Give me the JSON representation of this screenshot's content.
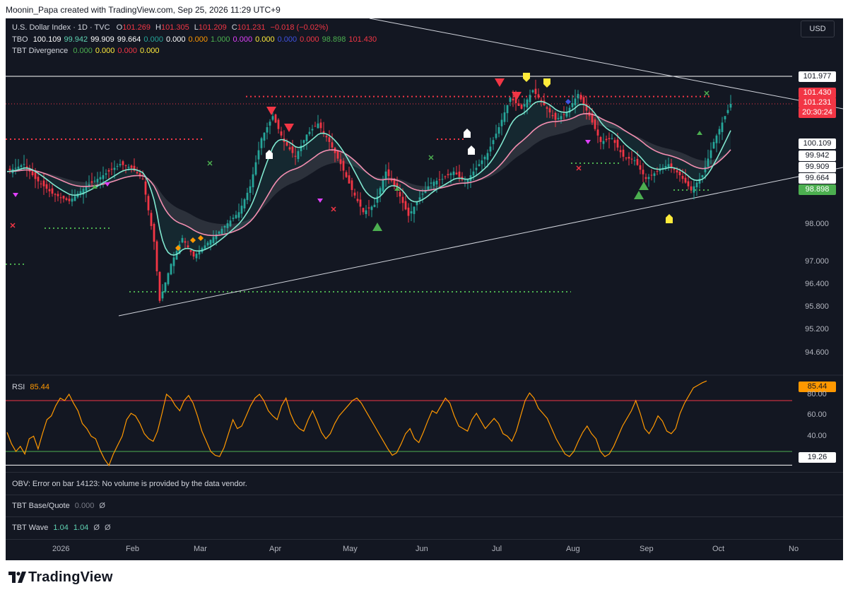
{
  "header": {
    "credit": "Moonin_Papa created with TradingView.com, Sep 25, 2026 11:29 UTC+9"
  },
  "legend": {
    "symbol": "U.S. Dollar Index · 1D · TVC",
    "o_label": "O",
    "o_value": "101.269",
    "h_label": "H",
    "h_value": "101.305",
    "l_label": "L",
    "l_value": "101.209",
    "c_label": "C",
    "c_value": "101.231",
    "change": "−0.018 (−0.02%)",
    "tbo_label": "TBO",
    "tbo_values": [
      {
        "text": "100.109",
        "color": "#ffffff"
      },
      {
        "text": "99.942",
        "color": "#5fd3b3"
      },
      {
        "text": "99.909",
        "color": "#ffffff"
      },
      {
        "text": "99.664",
        "color": "#ffffff"
      },
      {
        "text": "0.000",
        "color": "#26a69a"
      },
      {
        "text": "0.000",
        "color": "#ffffff"
      },
      {
        "text": "0.000",
        "color": "#ff9800"
      },
      {
        "text": "1.000",
        "color": "#4caf50"
      },
      {
        "text": "0.000",
        "color": "#e040fb"
      },
      {
        "text": "0.000",
        "color": "#ffeb3b"
      },
      {
        "text": "0.000",
        "color": "#3f51e0"
      },
      {
        "text": "0.000",
        "color": "#f23645"
      },
      {
        "text": "98.898",
        "color": "#4caf50"
      },
      {
        "text": "101.430",
        "color": "#f23645"
      }
    ],
    "div_label": "TBT Divergence",
    "div_values": [
      {
        "text": "0.000",
        "color": "#4caf50"
      },
      {
        "text": "0.000",
        "color": "#ffeb3b"
      },
      {
        "text": "0.000",
        "color": "#f23645"
      },
      {
        "text": "0.000",
        "color": "#ffeb3b"
      }
    ]
  },
  "currency_button": "USD",
  "price_axis": {
    "ticks": [
      "98.000",
      "97.000",
      "96.400",
      "95.800",
      "95.200",
      "94.600"
    ],
    "tags": [
      {
        "text": "101.977",
        "bg": "#ffffff",
        "fg": "#131722"
      },
      {
        "text": "101.430",
        "bg": "#f23645",
        "fg": "#ffffff"
      },
      {
        "text": "101.231",
        "bg": "#f23645",
        "fg": "#ffffff"
      },
      {
        "text": "20:30:24",
        "bg": "#f23645",
        "fg": "#ffffff"
      },
      {
        "text": "100.109",
        "bg": "#ffffff",
        "fg": "#131722"
      },
      {
        "text": "99.942",
        "bg": "#ffffff",
        "fg": "#131722"
      },
      {
        "text": "99.909",
        "bg": "#ffffff",
        "fg": "#131722"
      },
      {
        "text": "99.664",
        "bg": "#ffffff",
        "fg": "#131722"
      },
      {
        "text": "98.898",
        "bg": "#4caf50",
        "fg": "#ffffff"
      }
    ]
  },
  "rsi": {
    "label": "RSI",
    "value": "85.44",
    "ticks": [
      "80.00",
      "60.00",
      "40.00"
    ],
    "tag_value": "85.44",
    "low_tag": "19.26"
  },
  "obv": {
    "label": "OBV: Error on bar 14123: No volume is provided by the data vendor."
  },
  "base_quote": {
    "label": "TBT Base/Quote",
    "value": "0.000",
    "symbol": "Ø"
  },
  "wave": {
    "label": "TBT Wave",
    "v1": "1.04",
    "v2": "1.04",
    "s1": "Ø",
    "s2": "Ø"
  },
  "time_axis": {
    "labels": [
      "2026",
      "Feb",
      "Mar",
      "Apr",
      "May",
      "Jun",
      "Jul",
      "Aug",
      "Sep",
      "Oct",
      "No"
    ]
  },
  "brand": {
    "name": "TradingView"
  },
  "colors": {
    "up": "#26a69a",
    "down": "#f23645",
    "background": "#131722",
    "rsi": "#ff9800",
    "signal_up": "#4caf50",
    "signal_down": "#f23645"
  },
  "chart_data": {
    "type": "candlestick",
    "title": "U.S. Dollar Index · 1D · TVC",
    "ylim": [
      94.3,
      102.6
    ],
    "x": [
      "2026-01",
      "Feb",
      "Mar",
      "Apr",
      "May",
      "Jun",
      "Jul",
      "Aug",
      "Sep",
      "Oct"
    ],
    "close_path": [
      [
        0,
        99.4
      ],
      [
        6,
        99.6
      ],
      [
        10,
        99.2
      ],
      [
        16,
        98.8
      ],
      [
        22,
        98.6
      ],
      [
        28,
        99.0
      ],
      [
        34,
        99.3
      ],
      [
        40,
        99.6
      ],
      [
        44,
        99.5
      ],
      [
        48,
        99.2
      ],
      [
        52,
        97.5
      ],
      [
        54,
        95.9
      ],
      [
        58,
        96.9
      ],
      [
        62,
        97.6
      ],
      [
        66,
        97.1
      ],
      [
        70,
        97.4
      ],
      [
        74,
        97.7
      ],
      [
        78,
        98.0
      ],
      [
        82,
        98.3
      ],
      [
        86,
        99.0
      ],
      [
        90,
        100.3
      ],
      [
        94,
        100.9
      ],
      [
        98,
        100.2
      ],
      [
        102,
        99.8
      ],
      [
        106,
        100.4
      ],
      [
        110,
        100.7
      ],
      [
        114,
        100.2
      ],
      [
        118,
        99.6
      ],
      [
        122,
        98.9
      ],
      [
        126,
        98.3
      ],
      [
        130,
        98.5
      ],
      [
        134,
        99.4
      ],
      [
        138,
        98.9
      ],
      [
        142,
        98.2
      ],
      [
        146,
        98.7
      ],
      [
        150,
        99.1
      ],
      [
        154,
        99.2
      ],
      [
        158,
        99.4
      ],
      [
        162,
        99.1
      ],
      [
        166,
        99.5
      ],
      [
        170,
        99.9
      ],
      [
        174,
        100.6
      ],
      [
        178,
        101.4
      ],
      [
        182,
        101.1
      ],
      [
        186,
        101.6
      ],
      [
        190,
        101.2
      ],
      [
        194,
        100.8
      ],
      [
        198,
        101.0
      ],
      [
        202,
        101.5
      ],
      [
        206,
        100.9
      ],
      [
        210,
        100.2
      ],
      [
        214,
        100.3
      ],
      [
        218,
        99.8
      ],
      [
        222,
        99.7
      ],
      [
        226,
        99.2
      ],
      [
        230,
        99.4
      ],
      [
        234,
        99.6
      ],
      [
        238,
        99.3
      ],
      [
        242,
        98.9
      ],
      [
        246,
        99.3
      ],
      [
        250,
        100.2
      ],
      [
        254,
        100.9
      ],
      [
        256,
        101.23
      ]
    ],
    "levels": {
      "resistance": 101.977,
      "upper_dotted": 101.43,
      "last_close": 101.231,
      "support": 98.898
    },
    "tbo": {
      "fast": 100.109,
      "mid": 99.942,
      "slow": 99.909,
      "slowest": 99.664
    },
    "rsi": {
      "value": 85.44,
      "overbought": 70,
      "oversold": 30,
      "ylim": [
        15,
        90
      ],
      "values": [
        45,
        36,
        30,
        34,
        28,
        40,
        42,
        32,
        44,
        55,
        58,
        66,
        72,
        70,
        75,
        68,
        62,
        52,
        48,
        42,
        40,
        31,
        24,
        19,
        28,
        35,
        42,
        55,
        60,
        58,
        52,
        44,
        40,
        38,
        46,
        60,
        75,
        72,
        66,
        62,
        70,
        74,
        68,
        58,
        46,
        38,
        30,
        27,
        26,
        33,
        44,
        55,
        48,
        50,
        58,
        66,
        72,
        75,
        70,
        62,
        58,
        55,
        66,
        72,
        60,
        52,
        48,
        46,
        55,
        62,
        54,
        45,
        40,
        44,
        52,
        58,
        62,
        66,
        70,
        72,
        68,
        62,
        56,
        50,
        44,
        38,
        32,
        27,
        29,
        36,
        44,
        48,
        40,
        37,
        45,
        54,
        62,
        60,
        66,
        72,
        68,
        58,
        50,
        48,
        46,
        55,
        60,
        54,
        48,
        52,
        56,
        52,
        44,
        42,
        38,
        46,
        58,
        70,
        76,
        72,
        64,
        60,
        56,
        48,
        40,
        34,
        28,
        26,
        30,
        38,
        45,
        50,
        44,
        40,
        30,
        26,
        28,
        34,
        42,
        50,
        56,
        62,
        70,
        60,
        48,
        44,
        50,
        58,
        54,
        46,
        44,
        48,
        60,
        68,
        74,
        80,
        82,
        84,
        85.44
      ]
    }
  }
}
